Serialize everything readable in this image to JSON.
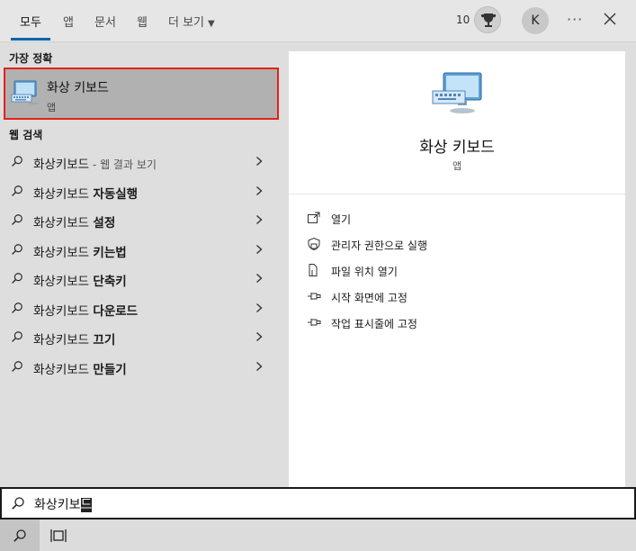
{
  "tabs": [
    {
      "label": "모두",
      "active": true
    },
    {
      "label": "앱"
    },
    {
      "label": "문서"
    },
    {
      "label": "웹"
    },
    {
      "label": "더 보기"
    }
  ],
  "header": {
    "points": "10",
    "avatar_initial": "K",
    "more_label": "···"
  },
  "best_match": {
    "header": "가장 정확",
    "title": "화상 키보드",
    "subtitle": "앱"
  },
  "web_search": {
    "header": "웹 검색",
    "items": [
      {
        "prefix": "화상키보드",
        "bold": "",
        "hint": " - 웹 결과 보기"
      },
      {
        "prefix": "화상키보드 ",
        "bold": "자동실행",
        "hint": ""
      },
      {
        "prefix": "화상키보드 ",
        "bold": "설정",
        "hint": ""
      },
      {
        "prefix": "화상키보드 ",
        "bold": "키는법",
        "hint": ""
      },
      {
        "prefix": "화상키보드 ",
        "bold": "단축키",
        "hint": ""
      },
      {
        "prefix": "화상키보드 ",
        "bold": "다운로드",
        "hint": ""
      },
      {
        "prefix": "화상키보드 ",
        "bold": "끄기",
        "hint": ""
      },
      {
        "prefix": "화상키보드 ",
        "bold": "만들기",
        "hint": ""
      }
    ]
  },
  "detail": {
    "title": "화상 키보드",
    "subtitle": "앱",
    "actions": [
      {
        "label": "열기",
        "icon": "open-icon"
      },
      {
        "label": "관리자 권한으로 실행",
        "icon": "shield-icon"
      },
      {
        "label": "파일 위치 열기",
        "icon": "file-location-icon"
      },
      {
        "label": "시작 화면에 고정",
        "icon": "pin-icon"
      },
      {
        "label": "작업 표시줄에 고정",
        "icon": "pin-icon"
      }
    ]
  },
  "search": {
    "value_main": "화상키보",
    "value_composing": "드"
  },
  "colors": {
    "accent": "#0a64ad",
    "highlight_border": "#e2231a",
    "selected_bg": "#b1b1b1"
  }
}
